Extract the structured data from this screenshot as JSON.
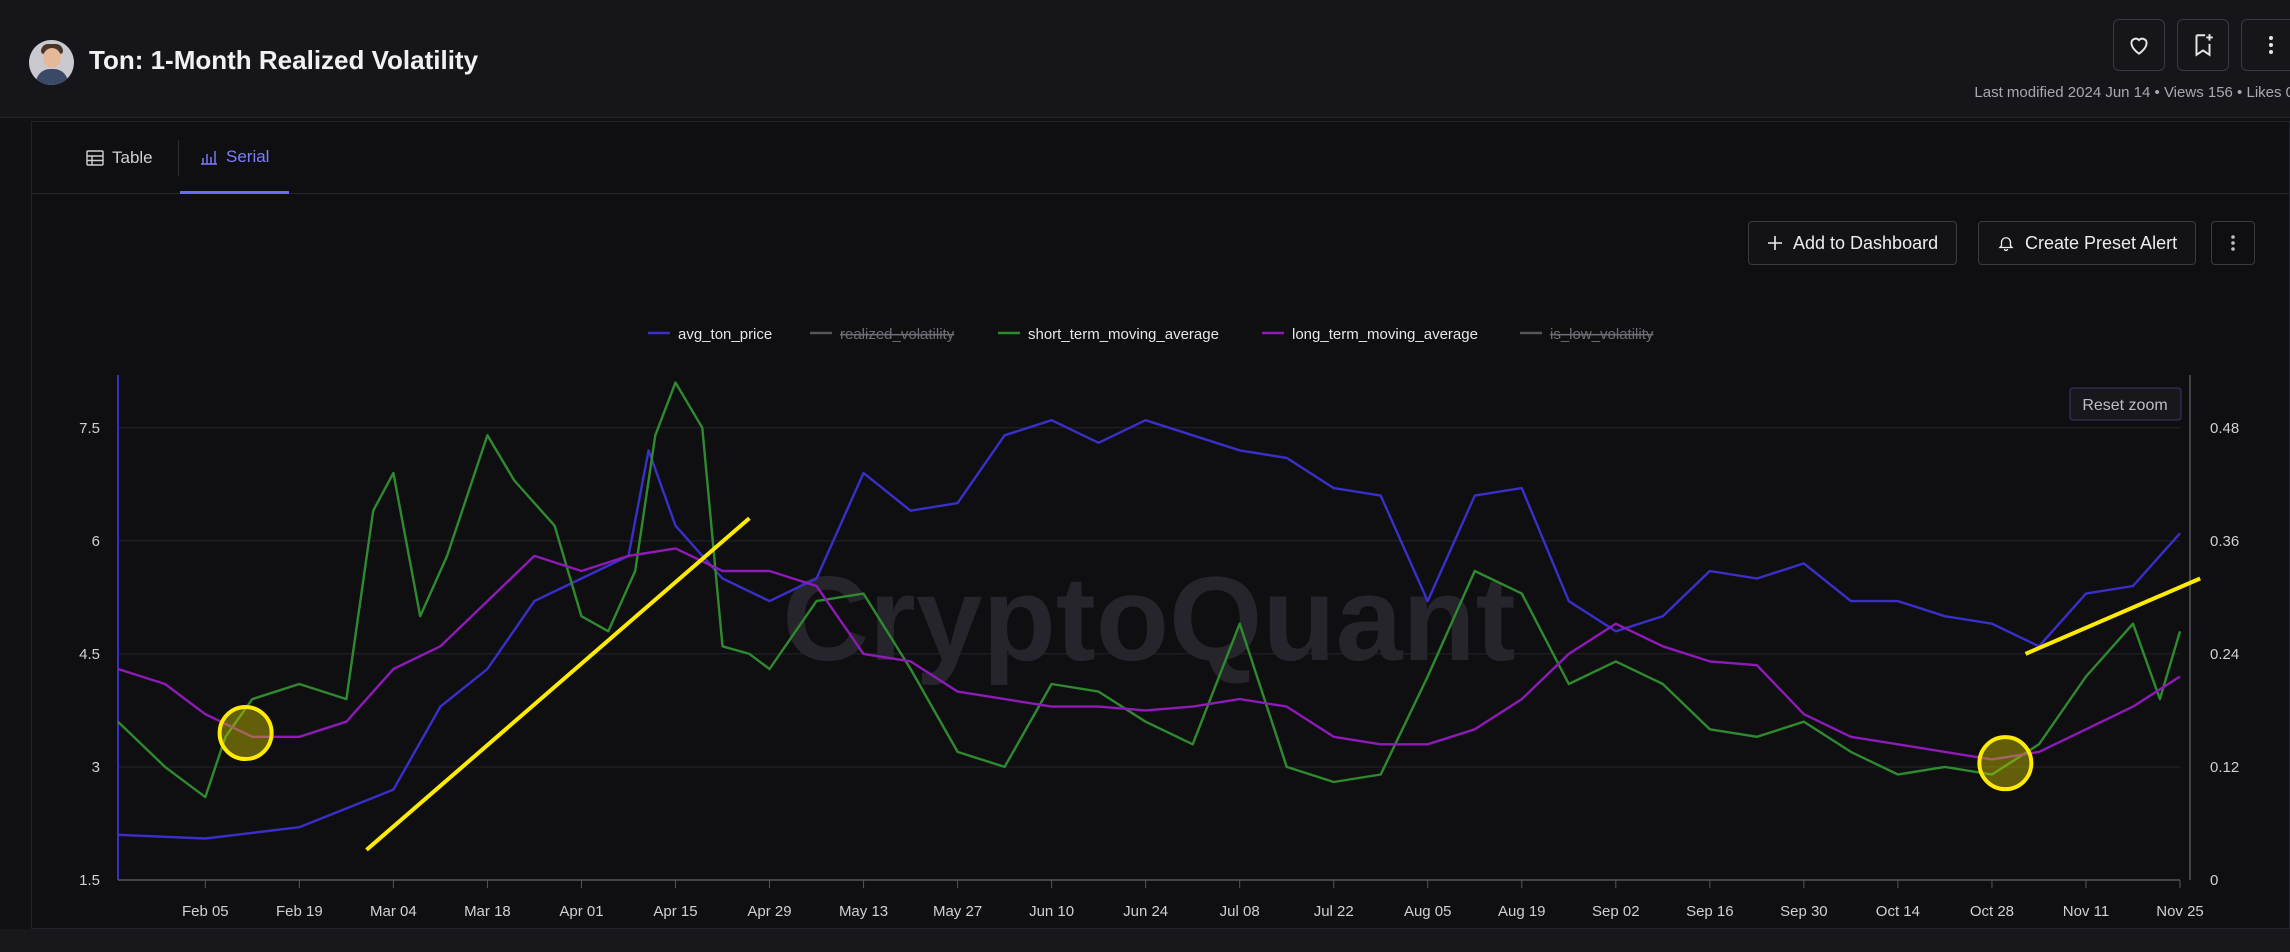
{
  "header": {
    "title": "Ton: 1-Month Realized Volatility",
    "meta": "Last modified 2024 Jun 14 • Views 156 • Likes 0"
  },
  "tabs": [
    {
      "label": "Table",
      "active": false
    },
    {
      "label": "Serial",
      "active": true
    }
  ],
  "actions": {
    "add_dashboard": "Add to Dashboard",
    "create_alert": "Create Preset Alert"
  },
  "colors": {
    "accent": "#6b69ff",
    "avg_price": "#3b2fc9",
    "short_ma": "#2f8a2f",
    "long_ma": "#8e1ab8",
    "annotation": "#ffeb00"
  },
  "chart_data": {
    "type": "line",
    "watermark": "CryptoQuant",
    "reset_zoom": "Reset zoom",
    "legend": [
      {
        "name": "avg_ton_price",
        "hidden": false,
        "color": "#3b2fc9"
      },
      {
        "name": "realized_volatility",
        "hidden": true,
        "color": "#666666"
      },
      {
        "name": "short_term_moving_average",
        "hidden": false,
        "color": "#2f8a2f"
      },
      {
        "name": "long_term_moving_average",
        "hidden": false,
        "color": "#8e1ab8"
      },
      {
        "name": "is_low_volatility",
        "hidden": true,
        "color": "#666666"
      }
    ],
    "legend_position": "top-center",
    "x_ticks": [
      "Feb 05",
      "Feb 19",
      "Mar 04",
      "Mar 18",
      "Apr 01",
      "Apr 15",
      "Apr 29",
      "May 13",
      "May 27",
      "Jun 10",
      "Jun 24",
      "Jul 08",
      "Jul 22",
      "Aug 05",
      "Aug 19",
      "Sep 02",
      "Sep 16",
      "Sep 30",
      "Oct 14",
      "Oct 28",
      "Nov 11",
      "Nov 25"
    ],
    "x_range": [
      "2024-01-23",
      "2024-11-25"
    ],
    "y_left_ticks": [
      "1.5",
      "3",
      "4.5",
      "6",
      "7.5"
    ],
    "y_left_range": [
      1.5,
      8.2
    ],
    "y_right_ticks": [
      "0",
      "0.12",
      "0.24",
      "0.36",
      "0.48"
    ],
    "y_right_range": [
      0,
      0.536
    ],
    "grid": true,
    "series": [
      {
        "name": "avg_ton_price",
        "axis": "left",
        "x": [
          "2024-01-23",
          "2024-02-05",
          "2024-02-19",
          "2024-03-04",
          "2024-03-11",
          "2024-03-18",
          "2024-03-25",
          "2024-04-01",
          "2024-04-08",
          "2024-04-11",
          "2024-04-15",
          "2024-04-22",
          "2024-04-29",
          "2024-05-06",
          "2024-05-13",
          "2024-05-20",
          "2024-05-27",
          "2024-06-03",
          "2024-06-10",
          "2024-06-17",
          "2024-06-24",
          "2024-07-01",
          "2024-07-08",
          "2024-07-15",
          "2024-07-22",
          "2024-07-29",
          "2024-08-05",
          "2024-08-12",
          "2024-08-19",
          "2024-08-26",
          "2024-09-02",
          "2024-09-09",
          "2024-09-16",
          "2024-09-23",
          "2024-09-30",
          "2024-10-07",
          "2024-10-14",
          "2024-10-21",
          "2024-10-28",
          "2024-11-04",
          "2024-11-11",
          "2024-11-18",
          "2024-11-25"
        ],
        "y": [
          2.1,
          2.05,
          2.2,
          2.7,
          3.8,
          4.3,
          5.2,
          5.5,
          5.8,
          7.2,
          6.2,
          5.5,
          5.2,
          5.5,
          6.9,
          6.4,
          6.5,
          7.4,
          7.6,
          7.3,
          7.6,
          7.4,
          7.2,
          7.1,
          6.7,
          6.6,
          5.2,
          6.6,
          6.7,
          5.2,
          4.8,
          5.0,
          5.6,
          5.5,
          5.7,
          5.2,
          5.2,
          5.0,
          4.9,
          4.6,
          5.3,
          5.4,
          6.1
        ]
      },
      {
        "name": "short_term_moving_average",
        "axis": "left",
        "x": [
          "2024-01-23",
          "2024-01-30",
          "2024-02-05",
          "2024-02-08",
          "2024-02-12",
          "2024-02-19",
          "2024-02-26",
          "2024-03-01",
          "2024-03-04",
          "2024-03-08",
          "2024-03-12",
          "2024-03-18",
          "2024-03-22",
          "2024-03-28",
          "2024-04-01",
          "2024-04-05",
          "2024-04-09",
          "2024-04-12",
          "2024-04-15",
          "2024-04-19",
          "2024-04-22",
          "2024-04-26",
          "2024-04-29",
          "2024-05-06",
          "2024-05-13",
          "2024-05-20",
          "2024-05-27",
          "2024-06-03",
          "2024-06-10",
          "2024-06-17",
          "2024-06-24",
          "2024-07-01",
          "2024-07-08",
          "2024-07-15",
          "2024-07-22",
          "2024-07-29",
          "2024-08-05",
          "2024-08-12",
          "2024-08-19",
          "2024-08-26",
          "2024-09-02",
          "2024-09-09",
          "2024-09-16",
          "2024-09-23",
          "2024-09-30",
          "2024-10-07",
          "2024-10-14",
          "2024-10-21",
          "2024-10-28",
          "2024-11-04",
          "2024-11-11",
          "2024-11-18",
          "2024-11-22",
          "2024-11-25"
        ],
        "y": [
          3.6,
          3.0,
          2.6,
          3.4,
          3.9,
          4.1,
          3.9,
          6.4,
          6.9,
          5.0,
          5.8,
          7.4,
          6.8,
          6.2,
          5.0,
          4.8,
          5.6,
          7.4,
          8.1,
          7.5,
          4.6,
          4.5,
          4.3,
          5.2,
          5.3,
          4.3,
          3.2,
          3.0,
          4.1,
          4.0,
          3.6,
          3.3,
          4.9,
          3.0,
          2.8,
          2.9,
          4.2,
          5.6,
          5.3,
          4.1,
          4.4,
          4.1,
          3.5,
          3.4,
          3.6,
          3.2,
          2.9,
          3.0,
          2.9,
          3.3,
          4.2,
          4.9,
          3.9,
          4.8
        ]
      },
      {
        "name": "long_term_moving_average",
        "axis": "left",
        "x": [
          "2024-01-23",
          "2024-01-30",
          "2024-02-05",
          "2024-02-12",
          "2024-02-19",
          "2024-02-26",
          "2024-03-04",
          "2024-03-11",
          "2024-03-18",
          "2024-03-25",
          "2024-04-01",
          "2024-04-08",
          "2024-04-15",
          "2024-04-22",
          "2024-04-29",
          "2024-05-06",
          "2024-05-13",
          "2024-05-20",
          "2024-05-27",
          "2024-06-03",
          "2024-06-10",
          "2024-06-17",
          "2024-06-24",
          "2024-07-01",
          "2024-07-08",
          "2024-07-15",
          "2024-07-22",
          "2024-07-29",
          "2024-08-05",
          "2024-08-12",
          "2024-08-19",
          "2024-08-26",
          "2024-09-02",
          "2024-09-09",
          "2024-09-16",
          "2024-09-23",
          "2024-09-30",
          "2024-10-07",
          "2024-10-14",
          "2024-10-21",
          "2024-10-28",
          "2024-11-04",
          "2024-11-11",
          "2024-11-18",
          "2024-11-25"
        ],
        "y": [
          4.3,
          4.1,
          3.7,
          3.4,
          3.4,
          3.6,
          4.3,
          4.6,
          5.2,
          5.8,
          5.6,
          5.8,
          5.9,
          5.6,
          5.6,
          5.4,
          4.5,
          4.4,
          4.0,
          3.9,
          3.8,
          3.8,
          3.75,
          3.8,
          3.9,
          3.8,
          3.4,
          3.3,
          3.3,
          3.5,
          3.9,
          4.5,
          4.9,
          4.6,
          4.4,
          4.35,
          3.7,
          3.4,
          3.3,
          3.2,
          3.1,
          3.2,
          3.5,
          3.8,
          4.2
        ]
      }
    ],
    "annotations": [
      {
        "type": "circle",
        "x": "2024-02-11",
        "y": 3.45
      },
      {
        "type": "circle",
        "x": "2024-10-30",
        "y": 3.05
      },
      {
        "type": "trend-line",
        "x1": "2024-02-29",
        "y1": 1.9,
        "x2": "2024-04-26",
        "y2": 6.3
      },
      {
        "type": "trend-line",
        "x1": "2024-11-02",
        "y1": 4.5,
        "x2": "2024-11-28",
        "y2": 5.5
      }
    ]
  }
}
